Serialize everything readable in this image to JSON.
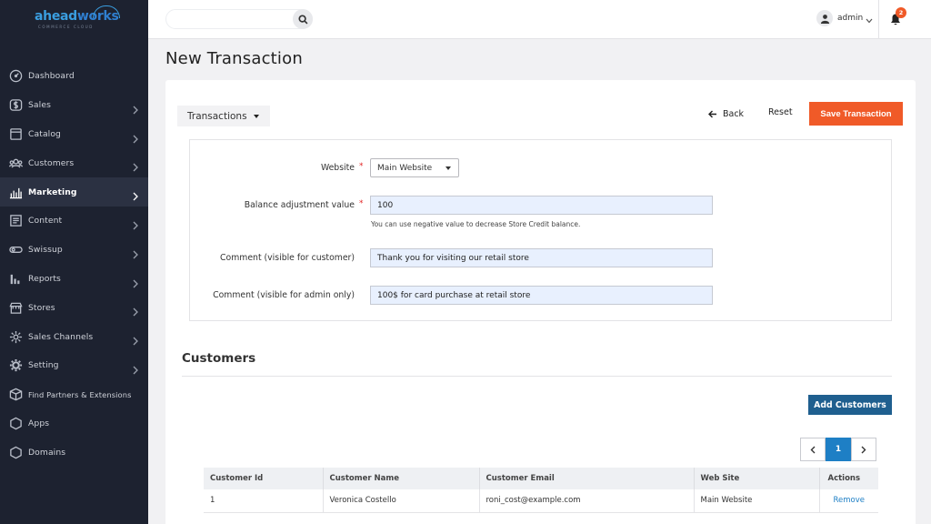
{
  "brand": {
    "name_part1": "ahead",
    "name_part2": "works",
    "tagline": "COMMERCE CLOUD"
  },
  "sidebar": {
    "items": [
      {
        "label": "Dashboard",
        "icon": "dashboard-icon",
        "has_chevron": false,
        "active": false
      },
      {
        "label": "Sales",
        "icon": "dollar-icon",
        "has_chevron": true,
        "active": false
      },
      {
        "label": "Catalog",
        "icon": "catalog-icon",
        "has_chevron": true,
        "active": false
      },
      {
        "label": "Customers",
        "icon": "customers-icon",
        "has_chevron": true,
        "active": false
      },
      {
        "label": "Marketing",
        "icon": "marketing-icon",
        "has_chevron": true,
        "active": true
      },
      {
        "label": "Content",
        "icon": "content-icon",
        "has_chevron": true,
        "active": false
      },
      {
        "label": "Swissup",
        "icon": "swissup-icon",
        "has_chevron": true,
        "active": false
      },
      {
        "label": "Reports",
        "icon": "reports-icon",
        "has_chevron": true,
        "active": false
      },
      {
        "label": "Stores",
        "icon": "stores-icon",
        "has_chevron": true,
        "active": false
      },
      {
        "label": "Sales Channels",
        "icon": "sales-channels-icon",
        "has_chevron": true,
        "active": false
      },
      {
        "label": "Setting",
        "icon": "gear-icon",
        "has_chevron": true,
        "active": false
      },
      {
        "label": "Find Partners & Extensions",
        "icon": "box-icon",
        "has_chevron": false,
        "active": false
      },
      {
        "label": "Apps",
        "icon": "hexagon-icon",
        "has_chevron": false,
        "active": false
      },
      {
        "label": "Domains",
        "icon": "hexagon-icon",
        "has_chevron": false,
        "active": false
      }
    ]
  },
  "topbar": {
    "search_value": "",
    "user_name": "admin",
    "notification_count": "2"
  },
  "page": {
    "title": "New Transaction"
  },
  "toolbar": {
    "dropdown_label": "Transactions",
    "back_label": "Back",
    "reset_label": "Reset",
    "save_label": "Save Transaction"
  },
  "form": {
    "website_label": "Website",
    "website_value": "Main Website",
    "balance_label": "Balance adjustment value",
    "balance_value": "100",
    "balance_hint": "You can use negative value to decrease Store Credit balance.",
    "comment_customer_label": "Comment (visible for customer)",
    "comment_customer_value": "Thank you for visiting our retail store",
    "comment_admin_label": "Comment (visible for admin only)",
    "comment_admin_value": "100$ for card purchase at retail store",
    "required_mark": "*"
  },
  "customers": {
    "title": "Customers",
    "add_label": "Add Customers",
    "current_page": "1",
    "columns": [
      "Customer Id",
      "Customer Name",
      "Customer Email",
      "Web Site",
      "Actions"
    ],
    "rows": [
      {
        "id": "1",
        "name": "Veronica Costello",
        "email": "roni_cost@example.com",
        "website": "Main Website",
        "action": "Remove"
      }
    ]
  },
  "colors": {
    "sidebar_bg": "#1d2230",
    "accent_orange": "#f05a28",
    "primary_blue": "#1f5f8f",
    "link_blue": "#1e7fc5"
  }
}
